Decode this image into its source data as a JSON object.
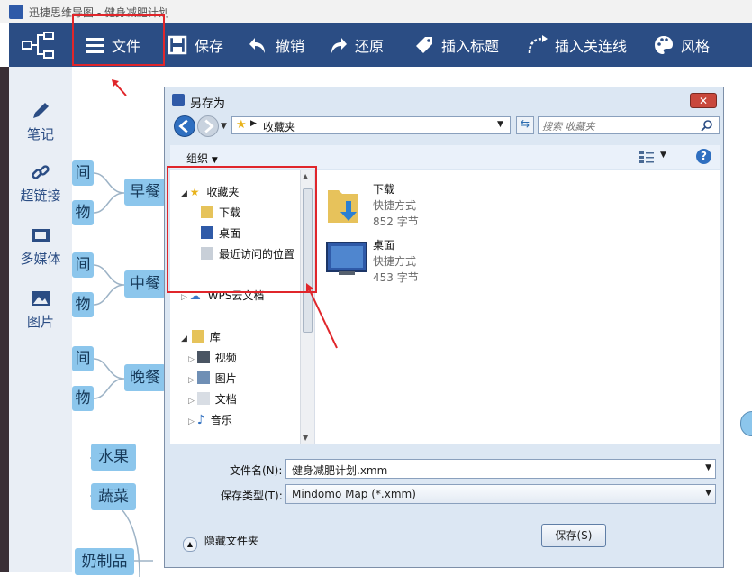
{
  "app": {
    "title": "迅捷思维导图 - 健身减肥计划"
  },
  "toolbar": {
    "file": "文件",
    "save": "保存",
    "undo": "撤销",
    "redo": "还原",
    "insert_title": "插入标题",
    "insert_connector": "插入关连线",
    "style": "风格"
  },
  "sidebar": {
    "notes": "笔记",
    "hyperlink": "超链接",
    "media": "多媒体",
    "image": "图片"
  },
  "canvas": {
    "nodes": [
      "间",
      "物",
      "早餐",
      "间",
      "中餐",
      "物",
      "间",
      "晚餐",
      "物",
      "水果",
      "蔬菜",
      "奶制品"
    ]
  },
  "dialog": {
    "title": "另存为",
    "address": "收藏夹",
    "search_placeholder": "搜索 收藏夹",
    "organize": "组织",
    "tree": {
      "favorites": "收藏夹",
      "downloads": "下载",
      "desktop": "桌面",
      "recent": "最近访问的位置",
      "wps": "WPS云文档",
      "library": "库",
      "videos": "视频",
      "pictures": "图片",
      "documents": "文档",
      "music": "音乐"
    },
    "files": [
      {
        "name": "下载",
        "type": "快捷方式",
        "size": "852 字节"
      },
      {
        "name": "桌面",
        "type": "快捷方式",
        "size": "453 字节"
      }
    ],
    "filename_label": "文件名(N):",
    "filename_value": "健身减肥计划.xmm",
    "filetype_label": "保存类型(T):",
    "filetype_value": "Mindomo Map (*.xmm)",
    "hide_folders": "隐藏文件夹",
    "save_button": "保存(S)"
  },
  "colors": {
    "toolbar_bg": "#2b4d84",
    "node_bg": "#8cc6ec",
    "highlight": "#e0262b"
  }
}
